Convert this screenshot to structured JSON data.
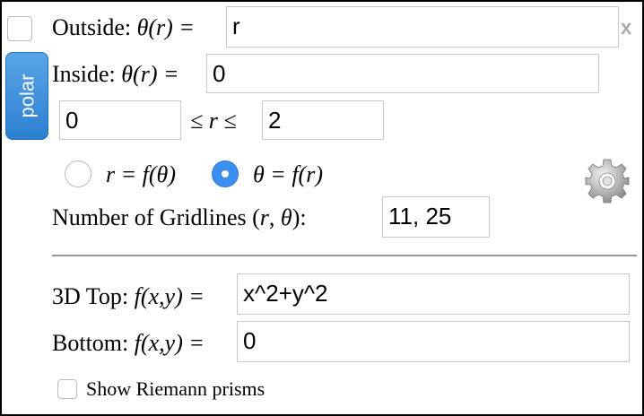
{
  "close_label": "x",
  "polar_button": "polar",
  "outside": {
    "label_prefix": "Outside: ",
    "label_func": "θ(r) =",
    "value": "r"
  },
  "inside": {
    "label_prefix": "Inside: ",
    "label_func": "θ(r) =",
    "value": "0"
  },
  "range": {
    "min": "0",
    "max": "2",
    "label": "≤ r ≤"
  },
  "radio": {
    "option1": "r = f(θ)",
    "option2": "θ = f(r)",
    "selected": "option2"
  },
  "gridlines": {
    "label_prefix": "Number of Gridlines (",
    "label_vars": "r",
    "label_sep": ", ",
    "label_var2": "θ",
    "label_suffix": "):",
    "value": "11, 25"
  },
  "top": {
    "label_prefix": "3D Top: ",
    "label_func": "f(x,y) =",
    "value": "x^2+y^2"
  },
  "bottom": {
    "label_prefix": "Bottom: ",
    "label_func": "f(x,y) =",
    "value": "0"
  },
  "riemann": {
    "label": "Show Riemann prisms",
    "checked": false
  },
  "colors": {
    "accent": "#3b8ff0",
    "polar_button": "#2c7fd0"
  },
  "icons": {
    "settings": "gear-icon",
    "close": "close-icon"
  }
}
